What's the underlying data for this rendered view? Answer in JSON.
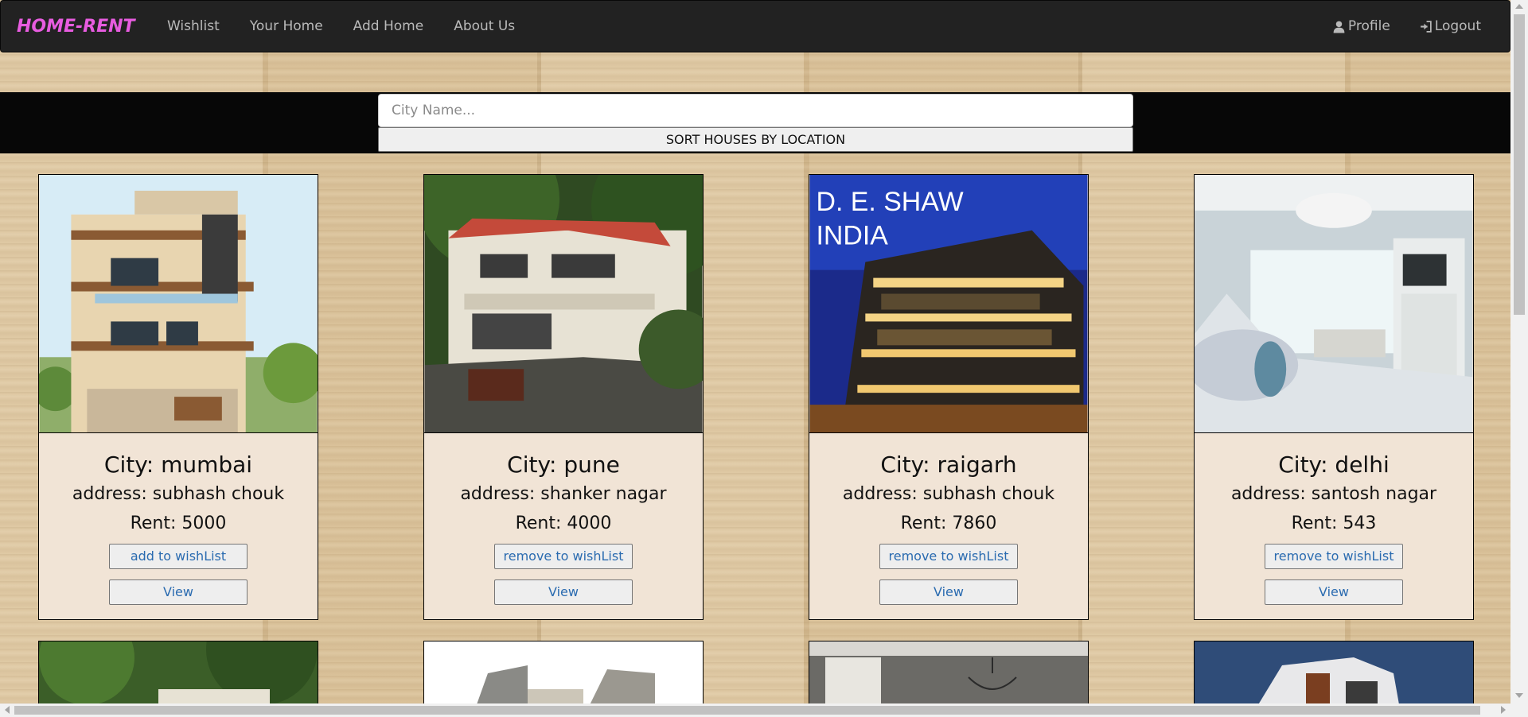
{
  "navbar": {
    "brand": "HOME-RENT",
    "links": [
      "Wishlist",
      "Your Home",
      "Add Home",
      "About Us"
    ],
    "profile": "Profile",
    "logout": "Logout"
  },
  "search": {
    "placeholder": "City Name...",
    "sort_label": "SORT HOUSES BY LOCATION"
  },
  "cards": [
    {
      "city": "City: mumbai",
      "address": "address: subhash chouk",
      "rent": "Rent: 5000",
      "wish": "add to wishList",
      "view": "View"
    },
    {
      "city": "City: pune",
      "address": "address: shanker nagar",
      "rent": "Rent: 4000",
      "wish": "remove to wishList",
      "view": "View"
    },
    {
      "city": "City: raigarh",
      "address": "address: subhash chouk",
      "rent": "Rent: 7860",
      "wish": "remove to wishList",
      "view": "View"
    },
    {
      "city": "City: delhi",
      "address": "address: santosh nagar",
      "rent": "Rent: 543",
      "wish": "remove to wishList",
      "view": "View"
    }
  ],
  "image_texts": {
    "deshaw_line1": "D. E. SHAW",
    "deshaw_line2": "INDIA"
  },
  "colors": {
    "brand": "#e85ce0",
    "navbar_bg": "#222222",
    "link_text": "#2a6bb0",
    "card_bg": "#f1e4d6"
  },
  "icons": {
    "profile": "user-icon",
    "logout": "logout-icon"
  }
}
